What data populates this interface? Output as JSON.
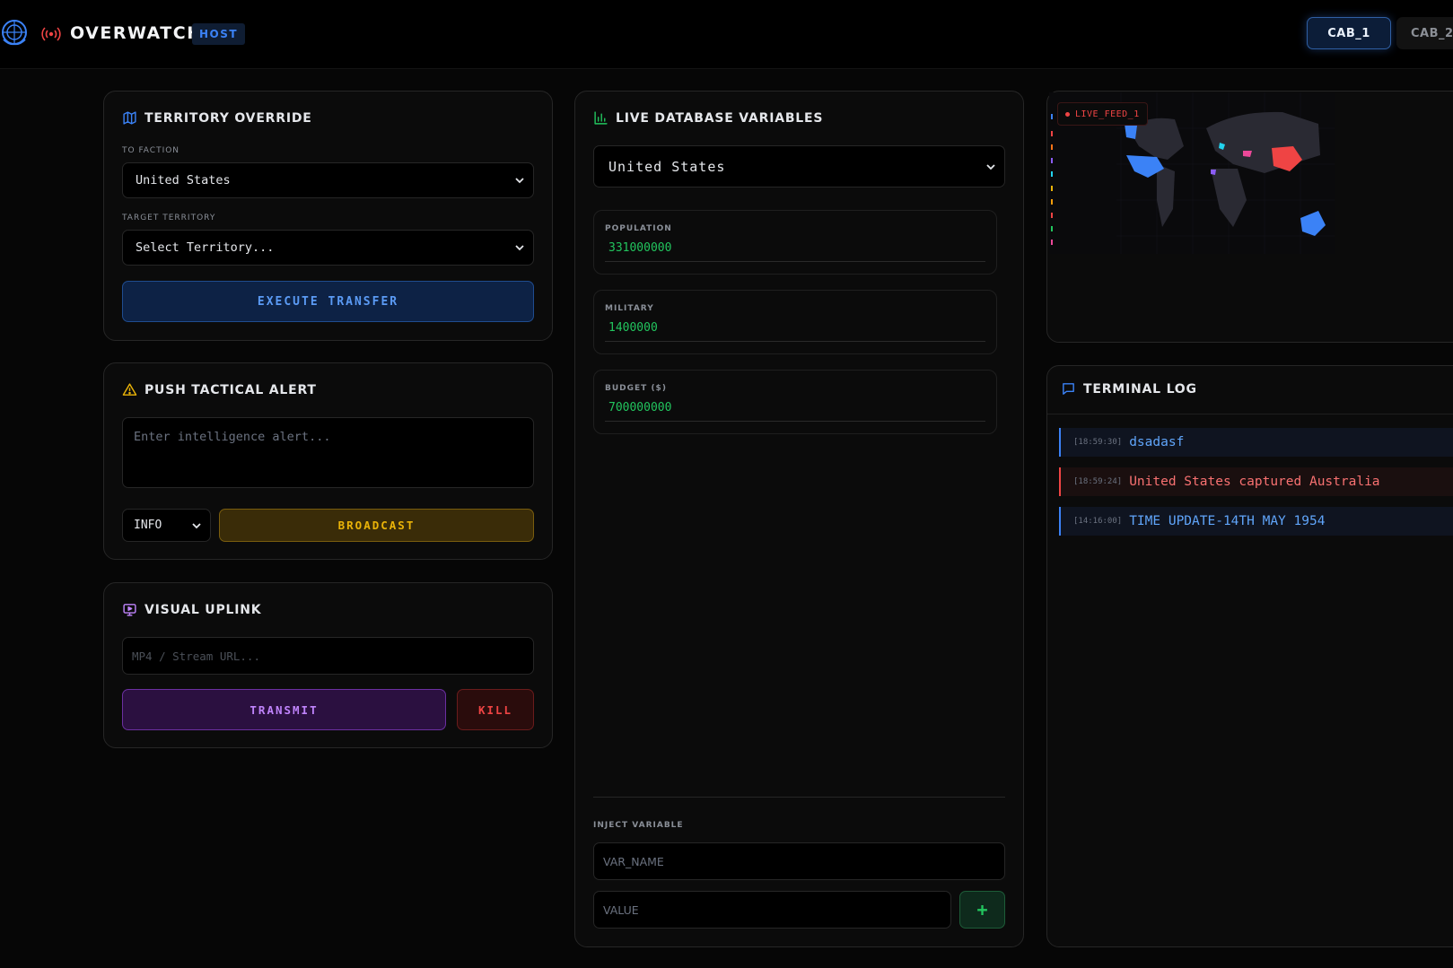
{
  "header": {
    "brand": "OVERWATCH",
    "badge": "HOST",
    "tabs": [
      {
        "label": "CAB_1",
        "active": true
      },
      {
        "label": "CAB_2",
        "active": false
      }
    ]
  },
  "territory_override": {
    "title": "TERRITORY OVERRIDE",
    "faction_label": "TO FACTION",
    "faction_value": "United States",
    "territory_label": "TARGET TERRITORY",
    "territory_value": "Select Territory...",
    "button": "EXECUTE TRANSFER"
  },
  "tactical_alert": {
    "title": "PUSH TACTICAL ALERT",
    "placeholder": "Enter intelligence alert...",
    "level_value": "INFO",
    "button": "BROADCAST"
  },
  "visual_uplink": {
    "title": "VISUAL UPLINK",
    "placeholder": "MP4 / Stream URL...",
    "transmit": "TRANSMIT",
    "kill": "KILL"
  },
  "database": {
    "title": "LIVE DATABASE VARIABLES",
    "nation_value": "United States",
    "stats": [
      {
        "label": "POPULATION",
        "value": "331000000"
      },
      {
        "label": "MILITARY",
        "value": "1400000"
      },
      {
        "label": "BUDGET ($)",
        "value": "700000000"
      }
    ],
    "inject_label": "INJECT VARIABLE",
    "var_name_placeholder": "VAR_NAME",
    "value_placeholder": "VALUE",
    "add_label": "+"
  },
  "live_feed": {
    "label": "LIVE_FEED_1",
    "map_colors": {
      "united_states": "#3b82f6",
      "china": "#ef4444",
      "australia": "#3b82f6",
      "land": "#2a2a33"
    }
  },
  "terminal": {
    "title": "TERMINAL LOG",
    "entries": [
      {
        "time": "[18:59:30]",
        "message": "dsadasf",
        "color": "#60a5fa",
        "border": "#3b82f6"
      },
      {
        "time": "[18:59:24]",
        "message": "United States captured Australia",
        "color": "#f87171",
        "border": "#ef4444"
      },
      {
        "time": "[14:16:00]",
        "message": "TIME UPDATE-14TH MAY 1954",
        "color": "#60a5fa",
        "border": "#3b82f6"
      }
    ]
  },
  "colors": {
    "accent_blue": "#3b82f6",
    "accent_green": "#22c55e",
    "accent_yellow": "#eab308",
    "accent_purple": "#c084fc",
    "accent_red": "#ef4444"
  }
}
